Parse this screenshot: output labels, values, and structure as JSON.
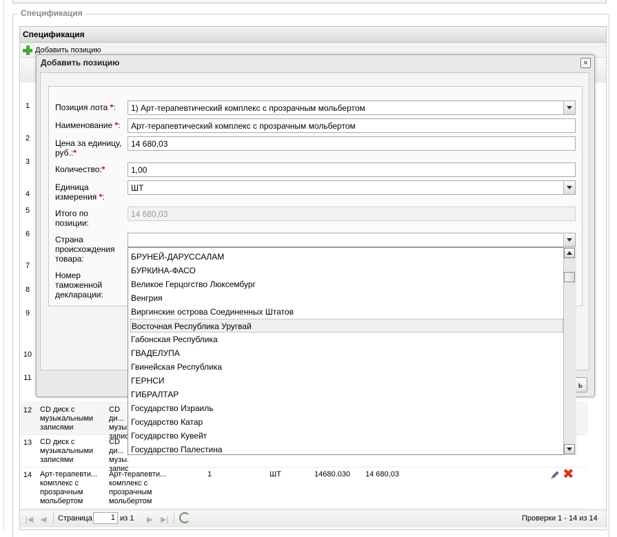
{
  "fieldset": {
    "legend": "Спецификация"
  },
  "grid": {
    "title": "Спецификация",
    "add_label": "Добавить позицию",
    "row_numbers": [
      "1",
      "2",
      "3",
      "4",
      "5",
      "6",
      "7",
      "8",
      "9",
      "10",
      "11"
    ],
    "rows": [
      {
        "num": "12",
        "name": "CD диск с музыкальными записями",
        "name2": "CD ди... музы... запис...",
        "qty": "",
        "unit": "",
        "price": "",
        "total": ""
      },
      {
        "num": "13",
        "name": "CD диск с музыкальными записями",
        "name2": "CD ди... музы... запис...",
        "qty": "",
        "unit": "",
        "price": "",
        "total": ""
      },
      {
        "num": "14",
        "name": "Арт-терапевти... комплекс с прозрачным мольбертом",
        "name2": "Арт-терапевти... комплекс с прозрачным мольбертом",
        "qty": "1",
        "unit": "ШТ",
        "price": "14680.030",
        "total": "14 680,03"
      }
    ]
  },
  "pager": {
    "page_label": "Страница",
    "page_value": "1",
    "of_label": "из 1",
    "summary": "Проверки 1 - 14 из 14"
  },
  "dialog": {
    "title": "Добавить позицию",
    "close": "×",
    "footer_button": "ь",
    "fields": {
      "lot_label": "Позиция лота",
      "lot_value": "1) Арт-терапевтический комплекс с прозрачным мольбертом",
      "name_label": "Наименование",
      "name_value": "Арт-терапевтический комплекс с прозрачным мольбертом",
      "price_label_1": "Цена за единицу,",
      "price_label_2": "руб.:",
      "price_value": "14 680,03",
      "qty_label": "Количество:",
      "qty_value": "1,00",
      "unit_label_1": "Единица",
      "unit_label_2": "измерения",
      "unit_value": "ШТ",
      "total_label_1": "Итого по",
      "total_label_2": "позиции:",
      "total_value": "14 680,03",
      "country_label_1": "Страна",
      "country_label_2": "происхождения",
      "country_label_3": "товара:",
      "country_value": "",
      "customs_label_1": "Номер",
      "customs_label_2": "таможенной",
      "customs_label_3": "декларации:"
    },
    "required_mark": "*",
    "colon": ":"
  },
  "country_options": [
    "БРУНЕЙ-ДАРУССАЛАМ",
    "БУРКИНА-ФАСО",
    "Великое Герцогство Люксембург",
    "Венгрия",
    "Виргинские острова Соединенных Штатов",
    "Восточная Республика Уругвай",
    "Габонская Республика",
    "ГВАДЕЛУПА",
    "Гвинейская Республика",
    "ГЕРНСИ",
    "ГИБРАЛТАР",
    "Государство Израиль",
    "Государство Катар",
    "Государство Кувейт",
    "Государство Палестина"
  ],
  "highlighted_option_index": 5,
  "colors": {
    "required": "#d00000",
    "add_icon": "#3cae2c",
    "delete_icon": "#e0301e"
  }
}
